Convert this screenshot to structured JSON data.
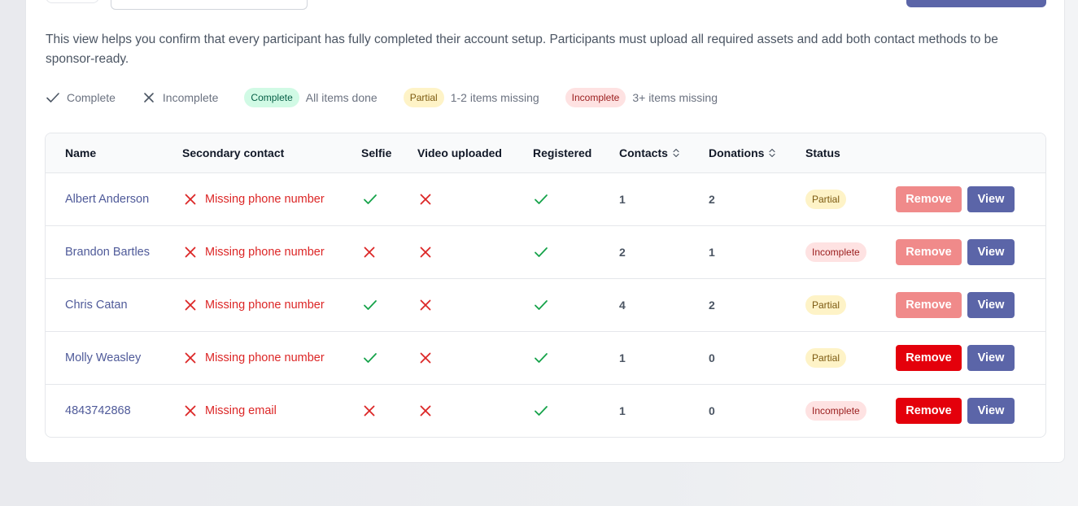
{
  "description": "This view helps you confirm that every participant has fully completed their account setup. Participants must upload all required assets and add both contact methods to be sponsor-ready.",
  "legend": {
    "check_label": "Complete",
    "cross_label": "Incomplete",
    "complete_pill": "Complete",
    "complete_desc": "All items done",
    "partial_pill": "Partial",
    "partial_desc": "1-2 items missing",
    "incomplete_pill": "Incomplete",
    "incomplete_desc": "3+ items missing"
  },
  "table": {
    "headers": {
      "name": "Name",
      "secondary": "Secondary contact",
      "selfie": "Selfie",
      "video": "Video uploaded",
      "registered": "Registered",
      "contacts": "Contacts",
      "donations": "Donations",
      "status": "Status"
    },
    "rows": [
      {
        "name": "Albert Anderson",
        "secondary": "Missing phone number",
        "selfie": true,
        "video": false,
        "registered": true,
        "contacts": "1",
        "donations": "2",
        "status": "Partial",
        "status_kind": "partial",
        "remove": "Remove",
        "remove_enabled": false,
        "view": "View"
      },
      {
        "name": "Brandon Bartles",
        "secondary": "Missing phone number",
        "selfie": false,
        "video": false,
        "registered": true,
        "contacts": "2",
        "donations": "1",
        "status": "Incomplete",
        "status_kind": "incomplete",
        "remove": "Remove",
        "remove_enabled": false,
        "view": "View"
      },
      {
        "name": "Chris Catan",
        "secondary": "Missing phone number",
        "selfie": true,
        "video": false,
        "registered": true,
        "contacts": "4",
        "donations": "2",
        "status": "Partial",
        "status_kind": "partial",
        "remove": "Remove",
        "remove_enabled": false,
        "view": "View"
      },
      {
        "name": "Molly Weasley",
        "secondary": "Missing phone number",
        "selfie": true,
        "video": false,
        "registered": true,
        "contacts": "1",
        "donations": "0",
        "status": "Partial",
        "status_kind": "partial",
        "remove": "Remove",
        "remove_enabled": true,
        "view": "View"
      },
      {
        "name": "4843742868",
        "secondary": "Missing email",
        "selfie": false,
        "video": false,
        "registered": true,
        "contacts": "1",
        "donations": "0",
        "status": "Incomplete",
        "status_kind": "incomplete",
        "remove": "Remove",
        "remove_enabled": true,
        "view": "View"
      }
    ]
  },
  "colors": {
    "accent": "#5b65a8",
    "success": "#16a34a",
    "danger": "#dc2626",
    "remove_active": "#e4000b",
    "remove_disabled": "#f08a8a"
  },
  "icons": {
    "yes": "check-icon",
    "no": "x-icon",
    "sort": "sort-icon"
  }
}
